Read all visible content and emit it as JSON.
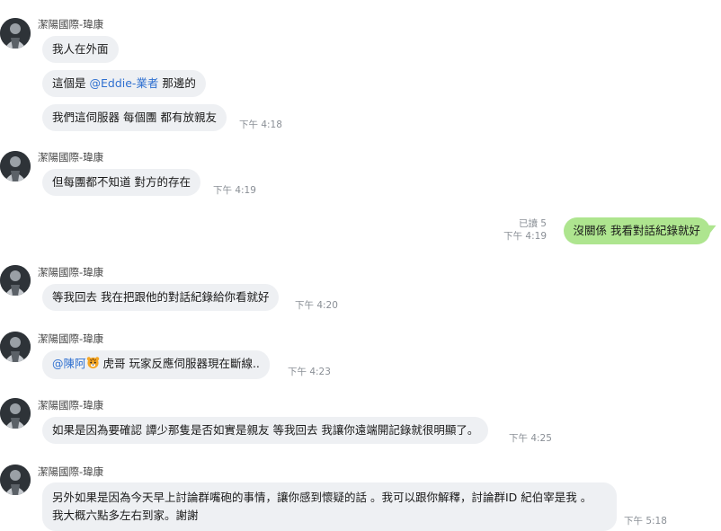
{
  "groups": [
    {
      "sender": "潔陽國際-瑋康",
      "messages": [
        {
          "text": "我人在外面"
        },
        {
          "pre": "這個是 ",
          "mention": "@Eddie-業者",
          "post": "  那邊的"
        },
        {
          "text": "我們這伺服器 每個團 都有放親友",
          "time": "下午 4:18"
        }
      ]
    },
    {
      "sender": "潔陽國際-瑋康",
      "messages": [
        {
          "text": "但每團都不知道 對方的存在",
          "time": "下午 4:19"
        }
      ]
    },
    {
      "sender": "潔陽國際-瑋康",
      "messages": [
        {
          "text": "等我回去 我在把跟他的對話紀錄給你看就好",
          "time": "下午 4:20"
        }
      ]
    },
    {
      "sender": "潔陽國際-瑋康",
      "messages": [
        {
          "mention": "@陳阿",
          "emoji": "tiger-face-icon",
          "post": " 虎哥  玩家反應伺服器現在斷線..",
          "time": "下午 4:23"
        }
      ]
    },
    {
      "sender": "潔陽國際-瑋康",
      "messages": [
        {
          "text": "如果是因為要確認 譚少那隻是否如實是親友 等我回去 我讓你遠端開記錄就很明顯了。",
          "time": "下午 4:25"
        }
      ]
    },
    {
      "sender": "潔陽國際-瑋康",
      "messages": [
        {
          "line1": "另外如果是因為今天早上討論群嘴砲的事情，讓你感到懷疑的話 。我可以跟你解釋，討論群ID 紀伯宰是我 。",
          "line2": "我大概六點多左右到家。謝謝",
          "time": "下午 5:18"
        }
      ]
    }
  ],
  "outgoing": {
    "text": "沒關係  我看對話紀錄就好",
    "read": "已讀 5",
    "time": "下午 4:19"
  },
  "colors": {
    "sent_bubble": "#aee58f",
    "received_bubble": "#eef0f3",
    "mention": "#2f70d0"
  }
}
